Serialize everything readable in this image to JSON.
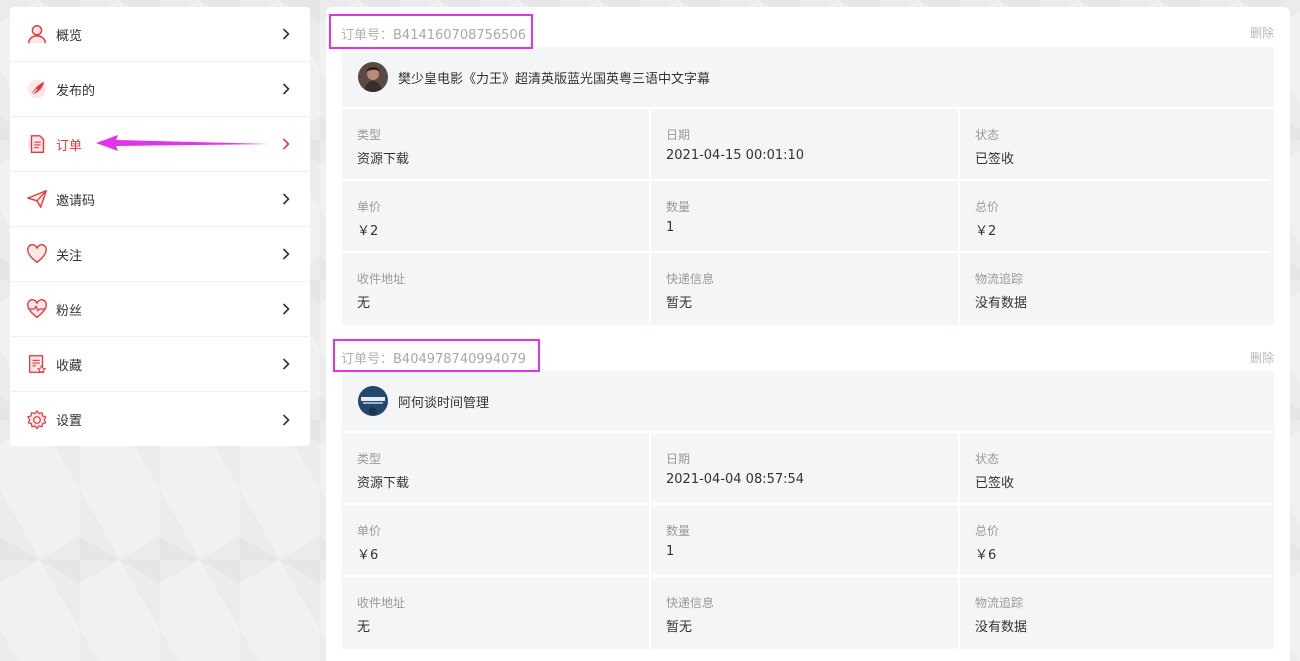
{
  "sidebar": {
    "items": [
      {
        "label": "概览",
        "icon": "user-icon"
      },
      {
        "label": "发布的",
        "icon": "feather-icon"
      },
      {
        "label": "订单",
        "icon": "document-icon",
        "active": true
      },
      {
        "label": "邀请码",
        "icon": "paper-plane-icon"
      },
      {
        "label": "关注",
        "icon": "heart-icon"
      },
      {
        "label": "粉丝",
        "icon": "heart-pulse-icon"
      },
      {
        "label": "收藏",
        "icon": "favorite-list-icon"
      },
      {
        "label": "设置",
        "icon": "gear-icon"
      }
    ]
  },
  "colors": {
    "accent": "#e4393c",
    "highlight": "#e133e8"
  },
  "orders": [
    {
      "order_label": "订单号：",
      "order_no": "B414160708756506",
      "delete_label": "删除",
      "product_title": "樊少皇电影《力王》超清英版蓝光国英粤三语中文字幕",
      "fields": [
        {
          "k": "类型",
          "v": "资源下载"
        },
        {
          "k": "日期",
          "v": "2021-04-15 00:01:10"
        },
        {
          "k": "状态",
          "v": "已签收"
        },
        {
          "k": "单价",
          "v": "￥2"
        },
        {
          "k": "数量",
          "v": "1"
        },
        {
          "k": "总价",
          "v": "￥2"
        },
        {
          "k": "收件地址",
          "v": "无"
        },
        {
          "k": "快递信息",
          "v": "暂无"
        },
        {
          "k": "物流追踪",
          "v": "没有数据"
        }
      ]
    },
    {
      "order_label": "订单号：",
      "order_no": "B404978740994079",
      "delete_label": "删除",
      "product_title": "阿何谈时间管理",
      "fields": [
        {
          "k": "类型",
          "v": "资源下载"
        },
        {
          "k": "日期",
          "v": "2021-04-04 08:57:54"
        },
        {
          "k": "状态",
          "v": "已签收"
        },
        {
          "k": "单价",
          "v": "￥6"
        },
        {
          "k": "数量",
          "v": "1"
        },
        {
          "k": "总价",
          "v": "￥6"
        },
        {
          "k": "收件地址",
          "v": "无"
        },
        {
          "k": "快递信息",
          "v": "暂无"
        },
        {
          "k": "物流追踪",
          "v": "没有数据"
        }
      ]
    }
  ]
}
